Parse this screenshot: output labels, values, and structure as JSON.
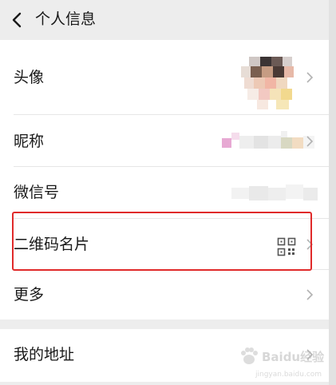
{
  "header": {
    "title": "个人信息",
    "back_icon": "back-arrow-icon"
  },
  "profile_items": [
    {
      "label": "头像"
    },
    {
      "label": "昵称"
    },
    {
      "label": "微信号"
    },
    {
      "label": "二维码名片"
    },
    {
      "label": "更多"
    }
  ],
  "address_item": {
    "label": "我的地址"
  },
  "watermark": {
    "text": "Baidu经验",
    "url": "jingyan.baidu.com"
  },
  "colors": {
    "highlight": "#e02a2a",
    "background": "#ededed",
    "surface": "#ffffff"
  }
}
